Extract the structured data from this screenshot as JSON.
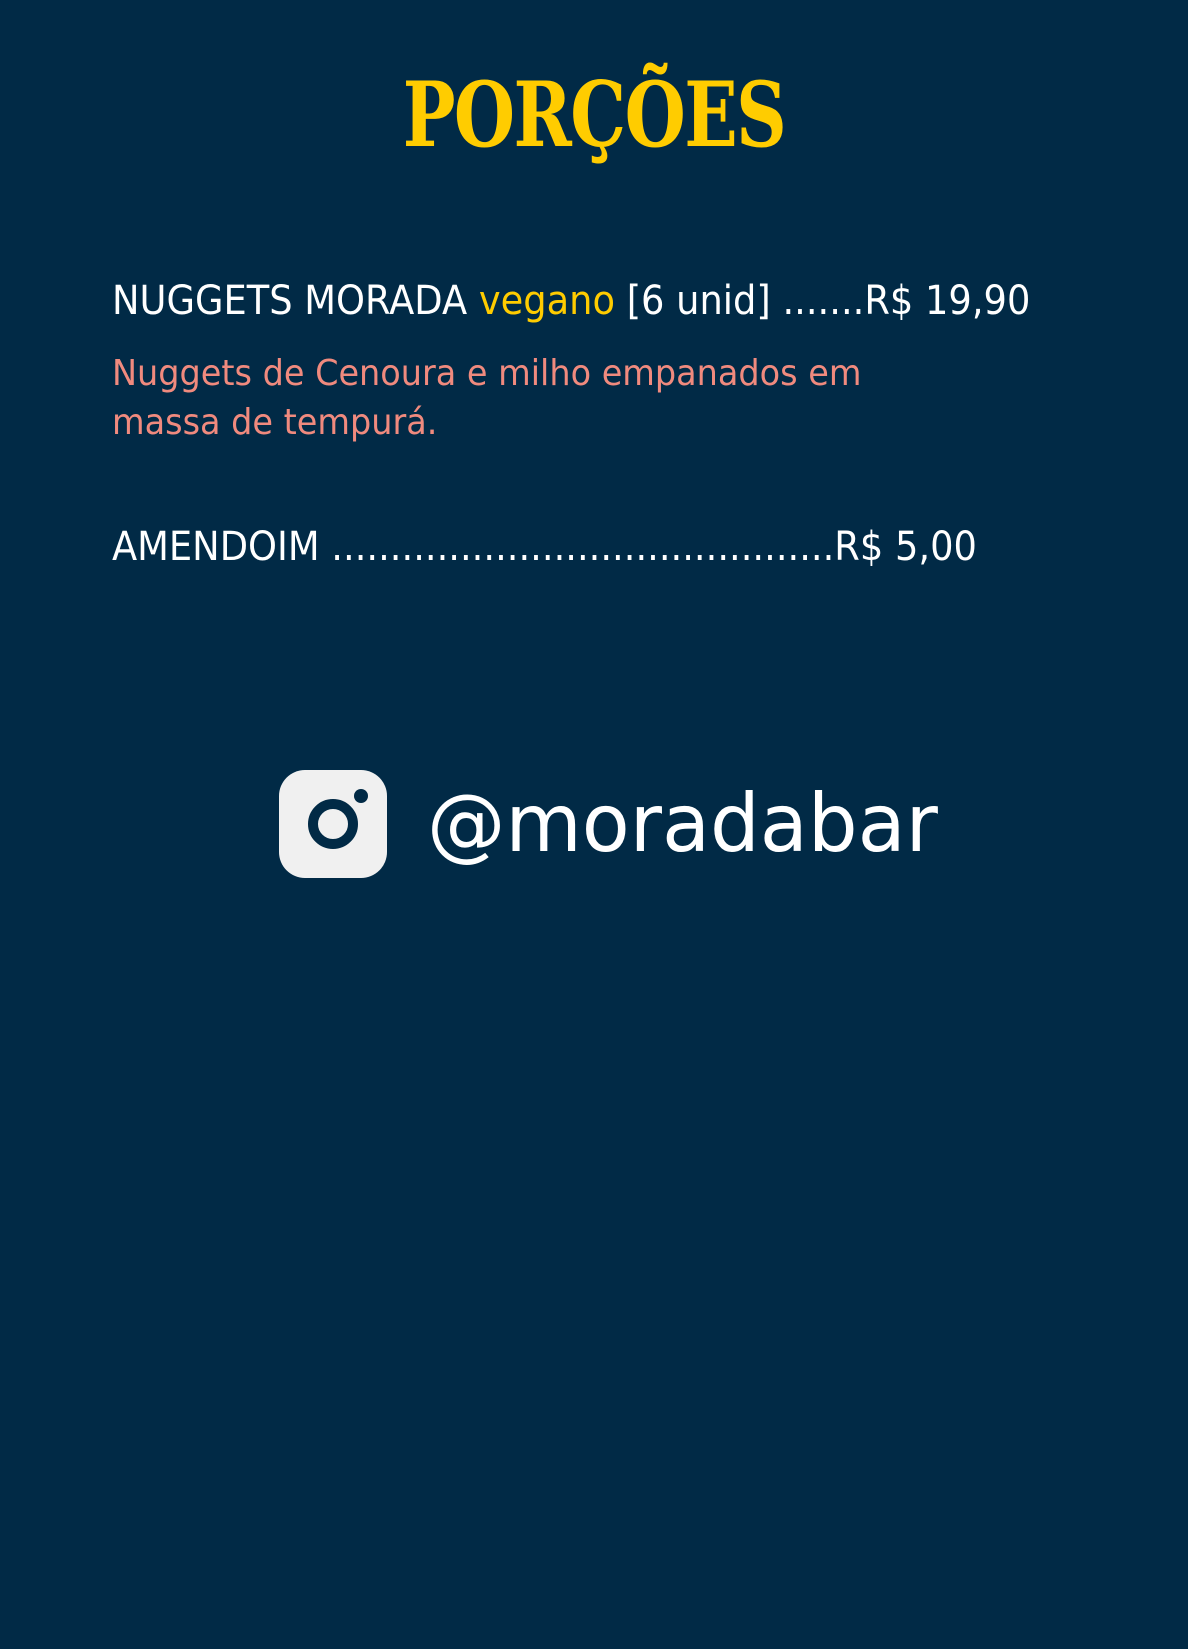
{
  "colors": {
    "background": "#012a46",
    "title": "#ffcc00",
    "item_text": "#ffffff",
    "vegan_tag": "#ffcc00",
    "description": "#f08a7e",
    "icon_fill": "#f0f0f0"
  },
  "title": "PORÇÕES",
  "items": [
    {
      "name": "NUGGETS MORADA",
      "tag": "vegano",
      "detail_price": "[6 unid] .......R$ 19,90",
      "description_line1": "Nuggets de Cenoura e milho empanados em",
      "description_line2": "massa de tempurá."
    },
    {
      "line": "AMENDOIM ...........................................R$ 5,00"
    }
  ],
  "social": {
    "icon": "instagram-icon",
    "handle": "@moradabar"
  }
}
